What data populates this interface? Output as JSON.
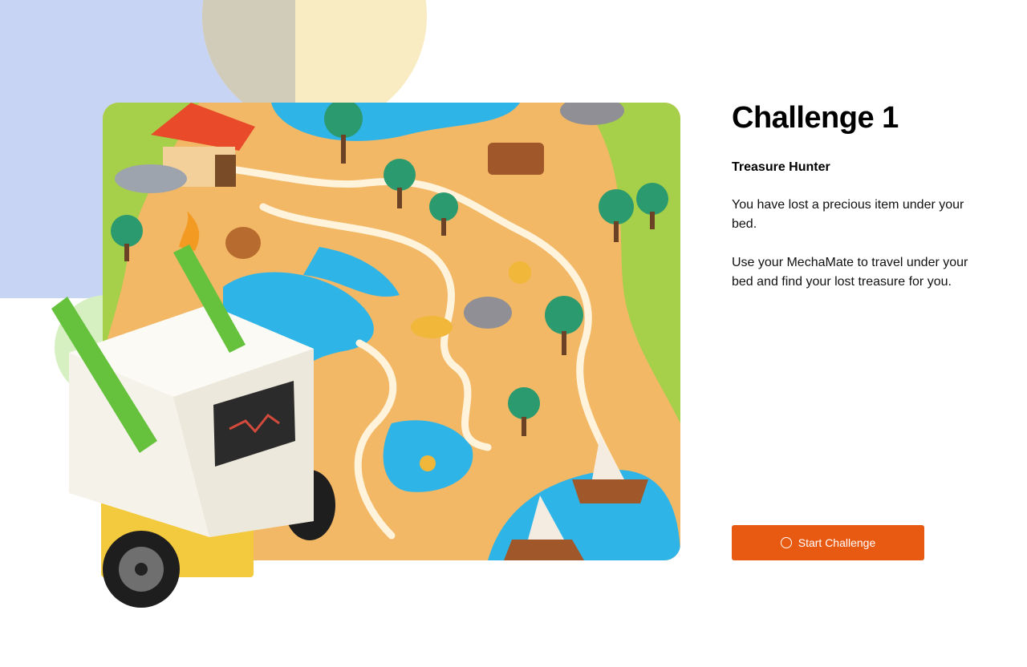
{
  "challenge": {
    "title": "Challenge 1",
    "subtitle": "Treasure Hunter",
    "paragraphs": [
      "You have lost a precious item under your bed.",
      "Use your MechaMate to travel under your bed and find your lost treasure for you."
    ],
    "start_label": "Start Challenge",
    "start_icon": "circle-icon"
  },
  "colors": {
    "accent": "#e85a12",
    "deco_blue": "#c8d4f4",
    "deco_cream": "#f9ebc2",
    "deco_green": "#d6f0c2"
  }
}
